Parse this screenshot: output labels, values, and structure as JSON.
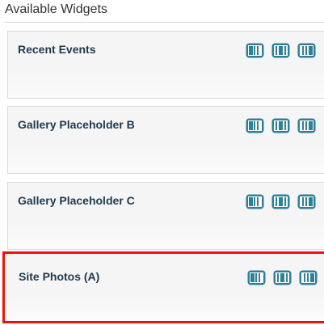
{
  "panel": {
    "title": "Available Widgets"
  },
  "widgets": [
    {
      "title": "Recent Events",
      "layouts": [
        "left-column-layout",
        "center-column-layout",
        "right-column-layout"
      ]
    },
    {
      "title": "Gallery Placeholder B",
      "layouts": [
        "left-column-layout",
        "center-column-layout",
        "right-column-layout"
      ]
    },
    {
      "title": "Gallery Placeholder C",
      "layouts": [
        "left-column-layout",
        "center-column-layout",
        "right-column-layout"
      ]
    },
    {
      "title": "Site Photos (A)",
      "layouts": [
        "left-column-layout",
        "center-column-layout",
        "right-column-layout"
      ],
      "highlighted": true
    }
  ],
  "colors": {
    "icon": "#2f7f99",
    "title_text": "#1f3a4d",
    "highlight_border": "#ee1111"
  }
}
